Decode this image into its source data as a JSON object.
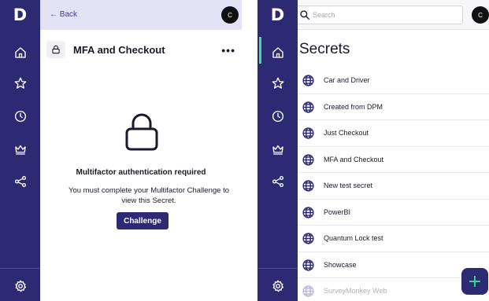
{
  "brand": {
    "logo_letter": "D",
    "primary": "#2b2a73",
    "accent": "#3ddc97"
  },
  "user": {
    "avatar_initial": "C"
  },
  "nav": [
    "home-icon",
    "star-icon",
    "clock-icon",
    "crown-icon",
    "share-icon",
    "gear-icon"
  ],
  "left": {
    "back_label": "← Back",
    "title": "MFA and Checkout",
    "more_label": "•••",
    "mfa_heading": "Multifactor authentication required",
    "mfa_text": "You must complete your Multifactor Challenge to view this Secret.",
    "challenge_label": "Challenge"
  },
  "right": {
    "search_placeholder": "Search",
    "heading": "Secrets",
    "items": [
      {
        "label": "Car and Driver"
      },
      {
        "label": "Created from DPM"
      },
      {
        "label": "Just Checkout"
      },
      {
        "label": "MFA and Checkout"
      },
      {
        "label": "New test secret"
      },
      {
        "label": "PowerBI"
      },
      {
        "label": "Quantum Lock test"
      },
      {
        "label": "Showcase"
      },
      {
        "label": "SurveyMonkey Web"
      }
    ],
    "fab_label": "+"
  }
}
